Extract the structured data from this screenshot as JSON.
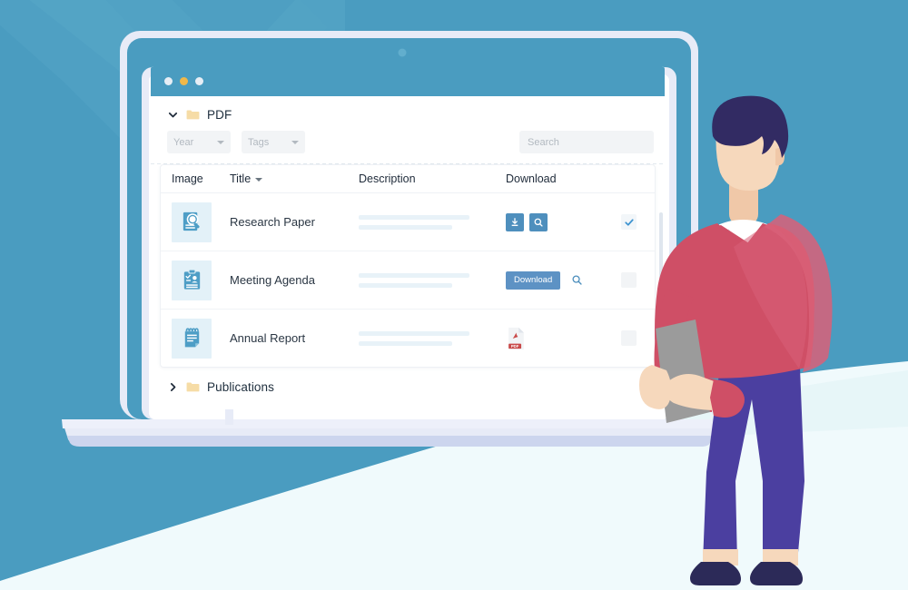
{
  "window": {
    "traffic_lights": [
      "close-dot",
      "minimize-dot",
      "maximize-dot"
    ]
  },
  "tree": {
    "open_folder": {
      "label": "PDF",
      "caret": "chevron-down-icon",
      "icon": "folder-icon",
      "expanded": true
    },
    "closed_folder": {
      "label": "Publications",
      "caret": "chevron-right-icon",
      "icon": "folder-icon",
      "expanded": false
    }
  },
  "filters": {
    "year": {
      "label": "Year",
      "caret": "chevron-down-icon"
    },
    "tags": {
      "label": "Tags",
      "caret": "chevron-down-icon"
    },
    "search": {
      "placeholder": "Search",
      "value": ""
    }
  },
  "table": {
    "columns": [
      {
        "key": "image",
        "label": "Image",
        "sortable": false
      },
      {
        "key": "title",
        "label": "Title",
        "sortable": true,
        "sort_icon": "chevron-down-icon"
      },
      {
        "key": "description",
        "label": "Description",
        "sortable": false
      },
      {
        "key": "download",
        "label": "Download",
        "sortable": false
      },
      {
        "key": "select",
        "label": "",
        "sortable": false
      }
    ],
    "rows": [
      {
        "thumbnail_icon": "document-magnifier-icon",
        "title": "Research Paper",
        "description_lines": 2,
        "download_style": "icon-buttons",
        "download_buttons": [
          {
            "name": "download-icon-button",
            "icon": "download-icon"
          },
          {
            "name": "preview-icon-button",
            "icon": "magnifier-icon"
          }
        ],
        "selected": true,
        "check_icon": "check-icon"
      },
      {
        "thumbnail_icon": "clipboard-person-icon",
        "title": "Meeting Agenda",
        "description_lines": 2,
        "download_style": "text-button",
        "download_label": "Download",
        "download_buttons": [
          {
            "name": "download-text-button",
            "icon": "none"
          },
          {
            "name": "preview-icon-button",
            "icon": "magnifier-icon"
          }
        ],
        "selected": false
      },
      {
        "thumbnail_icon": "notepad-icon",
        "title": "Annual Report",
        "description_lines": 2,
        "download_style": "pdf-file-icon",
        "pdf_badge_label": "PDF",
        "selected": false
      }
    ]
  },
  "colors": {
    "background": "#4a9cc0",
    "titlebar": "#4a9cc0",
    "accent_blue": "#4e8fbd",
    "button_blue": "#5d92c4",
    "thumb_bg": "#e3f1f8",
    "check_blue": "#3d93d0",
    "pdf_red": "#c94a4a",
    "folder_yellow": "#f6dca6",
    "ground_white": "#f0fafc",
    "sweater_red": "#cf4f66",
    "pants_purple": "#4b3fa0",
    "hair_navy": "#322b63",
    "skin": "#f6d8bc",
    "paper_grey": "#9b9b9b"
  },
  "illustration": {
    "character": "man-holding-document",
    "device": "laptop-with-file-manager",
    "watermark": "check-mark-watermark"
  }
}
